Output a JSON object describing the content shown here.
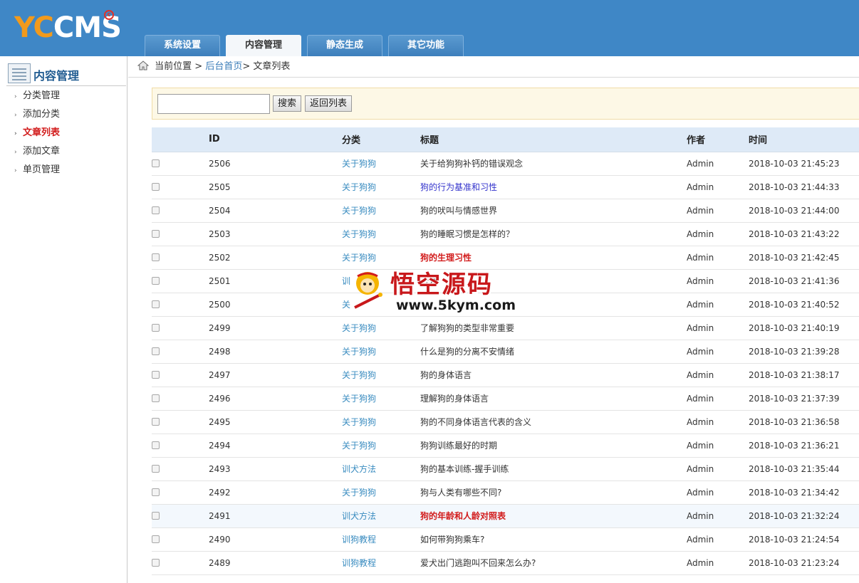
{
  "header": {
    "logo": "YCCMS",
    "nav": [
      "系统设置",
      "内容管理",
      "静态生成",
      "其它功能"
    ],
    "active_tab": "内容管理"
  },
  "sidebar": {
    "title": "内容管理",
    "items": [
      {
        "label": "分类管理",
        "active": false
      },
      {
        "label": "添加分类",
        "active": false
      },
      {
        "label": "文章列表",
        "active": true
      },
      {
        "label": "添加文章",
        "active": false
      },
      {
        "label": "单页管理",
        "active": false
      }
    ]
  },
  "breadcrumb": {
    "prefix": "当前位置 >",
    "home": "后台首页",
    "current": "> 文章列表"
  },
  "search": {
    "value": "",
    "search_label": "搜索",
    "back_label": "返回列表"
  },
  "table": {
    "headers": {
      "id": "ID",
      "category": "分类",
      "title": "标题",
      "author": "作者",
      "time": "时间"
    },
    "rows": [
      {
        "id": "2506",
        "category": "关于狗狗",
        "title": "关于给狗狗补钙的错误观念",
        "author": "Admin",
        "time": "2018-10-03 21:45:23",
        "style": ""
      },
      {
        "id": "2505",
        "category": "关于狗狗",
        "title": "狗的行为基准和习性",
        "author": "Admin",
        "time": "2018-10-03 21:44:33",
        "style": "blue"
      },
      {
        "id": "2504",
        "category": "关于狗狗",
        "title": "狗的吠叫与情感世界",
        "author": "Admin",
        "time": "2018-10-03 21:44:00",
        "style": ""
      },
      {
        "id": "2503",
        "category": "关于狗狗",
        "title": "狗的睡眠习惯是怎样的？",
        "author": "Admin",
        "time": "2018-10-03 21:43:22",
        "style": ""
      },
      {
        "id": "2502",
        "category": "关于狗狗",
        "title": "狗的生理习性",
        "author": "Admin",
        "time": "2018-10-03 21:42:45",
        "style": "red"
      },
      {
        "id": "2501",
        "category": "训",
        "title": "行为",
        "author": "Admin",
        "time": "2018-10-03 21:41:36",
        "style": ""
      },
      {
        "id": "2500",
        "category": "关",
        "title": "",
        "author": "Admin",
        "time": "2018-10-03 21:40:52",
        "style": ""
      },
      {
        "id": "2499",
        "category": "关于狗狗",
        "title": "了解狗狗的类型非常重要",
        "author": "Admin",
        "time": "2018-10-03 21:40:19",
        "style": ""
      },
      {
        "id": "2498",
        "category": "关于狗狗",
        "title": "什么是狗的分离不安情绪",
        "author": "Admin",
        "time": "2018-10-03 21:39:28",
        "style": ""
      },
      {
        "id": "2497",
        "category": "关于狗狗",
        "title": "狗的身体语言",
        "author": "Admin",
        "time": "2018-10-03 21:38:17",
        "style": ""
      },
      {
        "id": "2496",
        "category": "关于狗狗",
        "title": "理解狗的身体语言",
        "author": "Admin",
        "time": "2018-10-03 21:37:39",
        "style": ""
      },
      {
        "id": "2495",
        "category": "关于狗狗",
        "title": "狗的不同身体语言代表的含义",
        "author": "Admin",
        "time": "2018-10-03 21:36:58",
        "style": ""
      },
      {
        "id": "2494",
        "category": "关于狗狗",
        "title": "狗狗训练最好的时期",
        "author": "Admin",
        "time": "2018-10-03 21:36:21",
        "style": ""
      },
      {
        "id": "2493",
        "category": "训犬方法",
        "title": "狗的基本训练-握手训练",
        "author": "Admin",
        "time": "2018-10-03 21:35:44",
        "style": ""
      },
      {
        "id": "2492",
        "category": "关于狗狗",
        "title": "狗与人类有哪些不同?",
        "author": "Admin",
        "time": "2018-10-03 21:34:42",
        "style": ""
      },
      {
        "id": "2491",
        "category": "训犬方法",
        "title": "狗的年龄和人龄对照表",
        "author": "Admin",
        "time": "2018-10-03 21:32:24",
        "style": "red",
        "highlight": true
      },
      {
        "id": "2490",
        "category": "训狗教程",
        "title": "如何带狗狗乘车?",
        "author": "Admin",
        "time": "2018-10-03 21:24:54",
        "style": ""
      },
      {
        "id": "2489",
        "category": "训狗教程",
        "title": "爱犬出门逃跑叫不回来怎么办?",
        "author": "Admin",
        "time": "2018-10-03 21:23:24",
        "style": ""
      }
    ]
  },
  "watermark": {
    "text": "悟空源码",
    "url": "www.5kym.com"
  }
}
